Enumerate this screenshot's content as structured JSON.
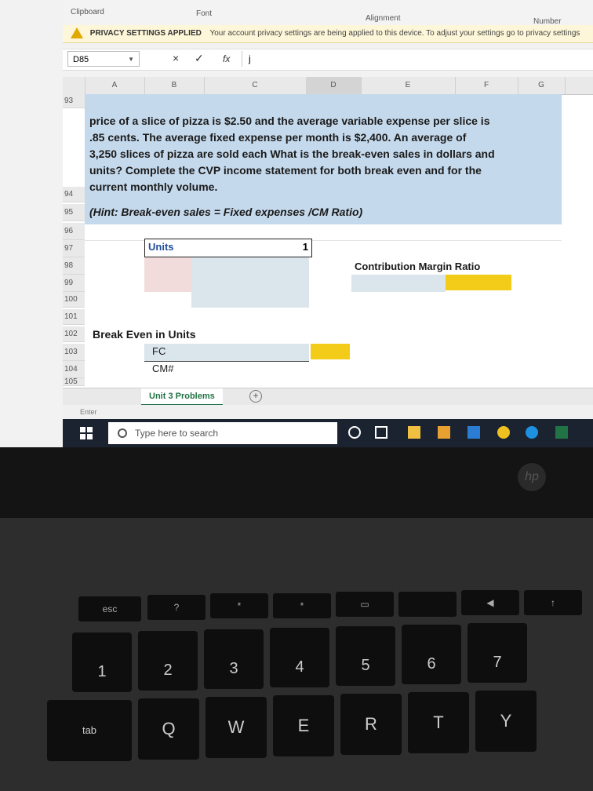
{
  "ribbon": {
    "clipboard": "Clipboard",
    "font": "Font",
    "alignment": "Alignment",
    "number": "Number"
  },
  "privacy": {
    "title": "PRIVACY SETTINGS APPLIED",
    "message": "Your account privacy settings are being applied to this device. To adjust your settings go to privacy settings"
  },
  "formula_bar": {
    "cell_ref": "D85",
    "cancel": "×",
    "enter": "✓",
    "fx": "fx",
    "content": "j"
  },
  "columns": [
    "A",
    "B",
    "C",
    "D",
    "E",
    "F",
    "G"
  ],
  "rows": [
    "93",
    "94",
    "95",
    "96",
    "97",
    "98",
    "99",
    "100",
    "101",
    "102",
    "103",
    "104",
    "105"
  ],
  "question": {
    "lines": [
      "price of a slice of pizza is $2.50 and the average variable expense per slice is",
      ".85 cents. The average fixed expense per month is $2,400. An average of",
      "3,250 slices of pizza are sold each What is the break-even sales in dollars and",
      "units? Complete the CVP income statement for both break even and for the",
      "current monthly volume."
    ],
    "hint": "(Hint: Break-even sales = Fixed expenses /CM Ratio)"
  },
  "cells": {
    "units_label": "Units",
    "units_value": "1",
    "cm_ratio_label": "Contribution Margin Ratio",
    "break_even_label": "Break Even in Units",
    "fc_label": "FC",
    "cm_label": "CM#"
  },
  "sheet_tab": "Unit 3 Problems",
  "status": "Enter",
  "taskbar": {
    "search_placeholder": "Type here to search"
  },
  "keyboard": {
    "fkeys": [
      "esc",
      "?",
      "*",
      "*",
      "▭",
      "",
      "◀",
      "↑"
    ],
    "numrow": [
      "1",
      "2",
      "3",
      "4",
      "5",
      "6",
      "7"
    ],
    "numrow_shift": [
      "!",
      "@",
      "#",
      "$",
      "%",
      "^",
      "&"
    ],
    "letters": [
      "Q",
      "W",
      "E",
      "R",
      "T",
      "Y"
    ],
    "tab": "tab",
    "hp": "hp"
  },
  "colors": {
    "header_blue": "#c5d9ec",
    "yellow_fill": "#f2cc18",
    "excel_green": "#217346"
  }
}
